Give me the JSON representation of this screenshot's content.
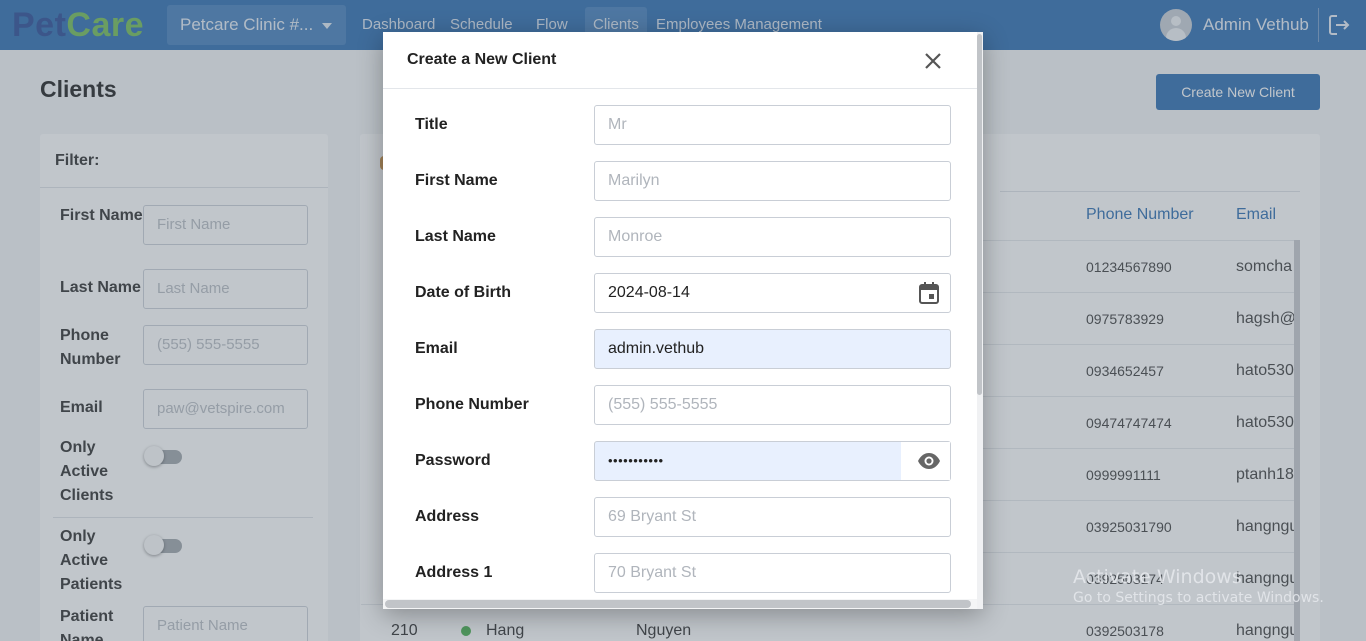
{
  "brand": {
    "logo_part1": "Pet",
    "logo_part2": "Care"
  },
  "header": {
    "clinic": "Petcare Clinic #...",
    "nav": [
      "Dashboard",
      "Schedule",
      "Flow",
      "Clients",
      "Employees Management"
    ],
    "active_nav": "Clients",
    "user": "Admin Vethub"
  },
  "page": {
    "title": "Clients",
    "create_button": "Create New Client"
  },
  "filter": {
    "title": "Filter:",
    "first_name_label": "First Name",
    "first_name_placeholder": "First Name",
    "last_name_label": "Last Name",
    "last_name_placeholder": "Last Name",
    "phone_label": "Phone Number",
    "phone_placeholder": "(555) 555-5555",
    "email_label": "Email",
    "email_placeholder": "paw@vetspire.com",
    "only_active_clients_label": "Only Active Clients",
    "only_active_clients_on": false,
    "only_active_patients_label": "Only Active Patients",
    "only_active_patients_on": false,
    "patient_name_label": "Patient Name",
    "patient_name_placeholder": "Patient Name"
  },
  "table": {
    "columns": [
      "Phone Number",
      "Email"
    ],
    "rows": [
      {
        "phone": "01234567890",
        "email": "somcha"
      },
      {
        "phone": "0975783929",
        "email": "hagsh@"
      },
      {
        "phone": "0934652457",
        "email": "hato530"
      },
      {
        "phone": "09474747474",
        "email": "hato530"
      },
      {
        "phone": "0999991111",
        "email": "ptanh18"
      },
      {
        "phone": "03925031790",
        "email": "hangngu"
      },
      {
        "phone": "0392503174",
        "email": "hangngu"
      },
      {
        "id": "210",
        "first_name": "Hang",
        "last_name": "Nguyen",
        "phone": "0392503178",
        "email": "hangngu"
      }
    ]
  },
  "modal": {
    "title": "Create a New Client",
    "fields": {
      "title": {
        "label": "Title",
        "placeholder": "Mr"
      },
      "first_name": {
        "label": "First Name",
        "placeholder": "Marilyn"
      },
      "last_name": {
        "label": "Last Name",
        "placeholder": "Monroe"
      },
      "dob": {
        "label": "Date of Birth",
        "value": "2024-08-14"
      },
      "email": {
        "label": "Email",
        "value": "admin.vethub"
      },
      "phone": {
        "label": "Phone Number",
        "placeholder": "(555) 555-5555"
      },
      "password": {
        "label": "Password",
        "value": "•••••••••••"
      },
      "address": {
        "label": "Address",
        "placeholder": "69 Bryant St"
      },
      "address1": {
        "label": "Address 1",
        "placeholder": "70 Bryant St"
      }
    }
  },
  "watermark": {
    "line1": "Activate Windows",
    "line2": "Go to Settings to activate Windows."
  },
  "colors": {
    "primary": "#1f64ad",
    "logo_dark": "#1b3f8f",
    "logo_green": "#6ab94a",
    "status_active": "#3cab43"
  }
}
